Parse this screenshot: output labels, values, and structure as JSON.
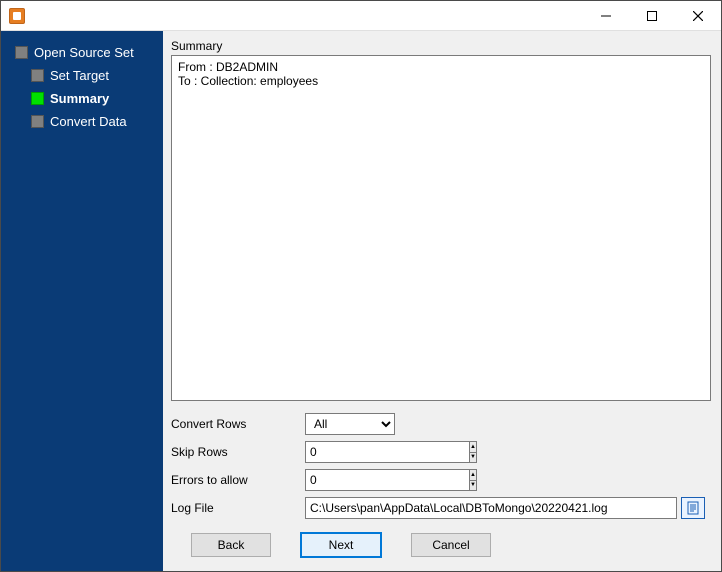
{
  "window": {
    "title": ""
  },
  "sidebar": {
    "items": [
      {
        "label": "Open Source Set",
        "level": 0,
        "active": false
      },
      {
        "label": "Set Target",
        "level": 1,
        "active": false
      },
      {
        "label": "Summary",
        "level": 1,
        "active": true
      },
      {
        "label": "Convert Data",
        "level": 1,
        "active": false
      }
    ]
  },
  "summary": {
    "heading": "Summary",
    "body": "From : DB2ADMIN\nTo : Collection: employees"
  },
  "form": {
    "convert_rows": {
      "label": "Convert Rows",
      "value": "All"
    },
    "skip_rows": {
      "label": "Skip Rows",
      "value": "0"
    },
    "errors": {
      "label": "Errors to allow",
      "value": "0"
    },
    "log_file": {
      "label": "Log File",
      "value": "C:\\Users\\pan\\AppData\\Local\\DBToMongo\\20220421.log"
    }
  },
  "buttons": {
    "back": "Back",
    "next": "Next",
    "cancel": "Cancel"
  }
}
